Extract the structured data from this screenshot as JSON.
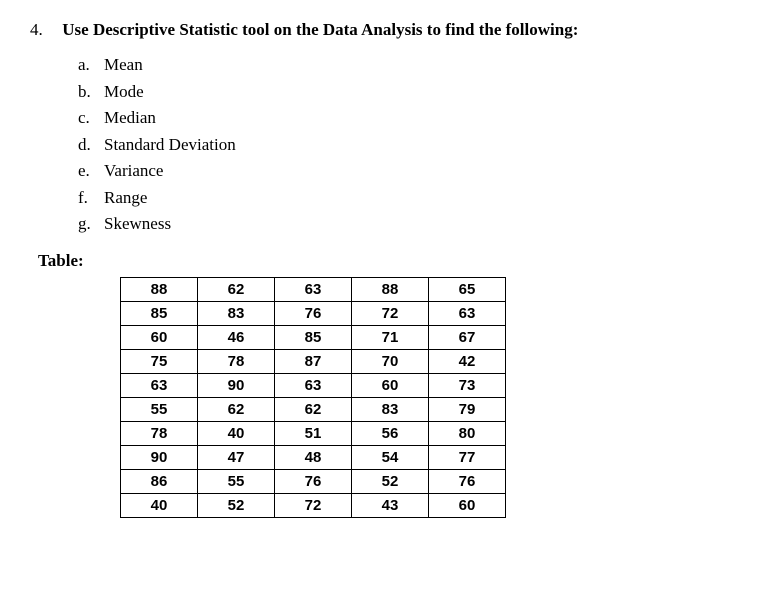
{
  "question": {
    "number": "4.",
    "text": "Use Descriptive Statistic tool on the Data Analysis to find the following:"
  },
  "sublist": [
    {
      "letter": "a.",
      "label": "Mean"
    },
    {
      "letter": "b.",
      "label": "Mode"
    },
    {
      "letter": "c.",
      "label": "Median"
    },
    {
      "letter": "d.",
      "label": "Standard Deviation"
    },
    {
      "letter": "e.",
      "label": "Variance"
    },
    {
      "letter": "f.",
      "label": "Range"
    },
    {
      "letter": "g.",
      "label": "Skewness"
    }
  ],
  "table_label": "Table:",
  "chart_data": {
    "type": "table",
    "rows": [
      [
        88,
        62,
        63,
        88,
        65
      ],
      [
        85,
        83,
        76,
        72,
        63
      ],
      [
        60,
        46,
        85,
        71,
        67
      ],
      [
        75,
        78,
        87,
        70,
        42
      ],
      [
        63,
        90,
        63,
        60,
        73
      ],
      [
        55,
        62,
        62,
        83,
        79
      ],
      [
        78,
        40,
        51,
        56,
        80
      ],
      [
        90,
        47,
        48,
        54,
        77
      ],
      [
        86,
        55,
        76,
        52,
        76
      ],
      [
        40,
        52,
        72,
        43,
        60
      ]
    ]
  }
}
